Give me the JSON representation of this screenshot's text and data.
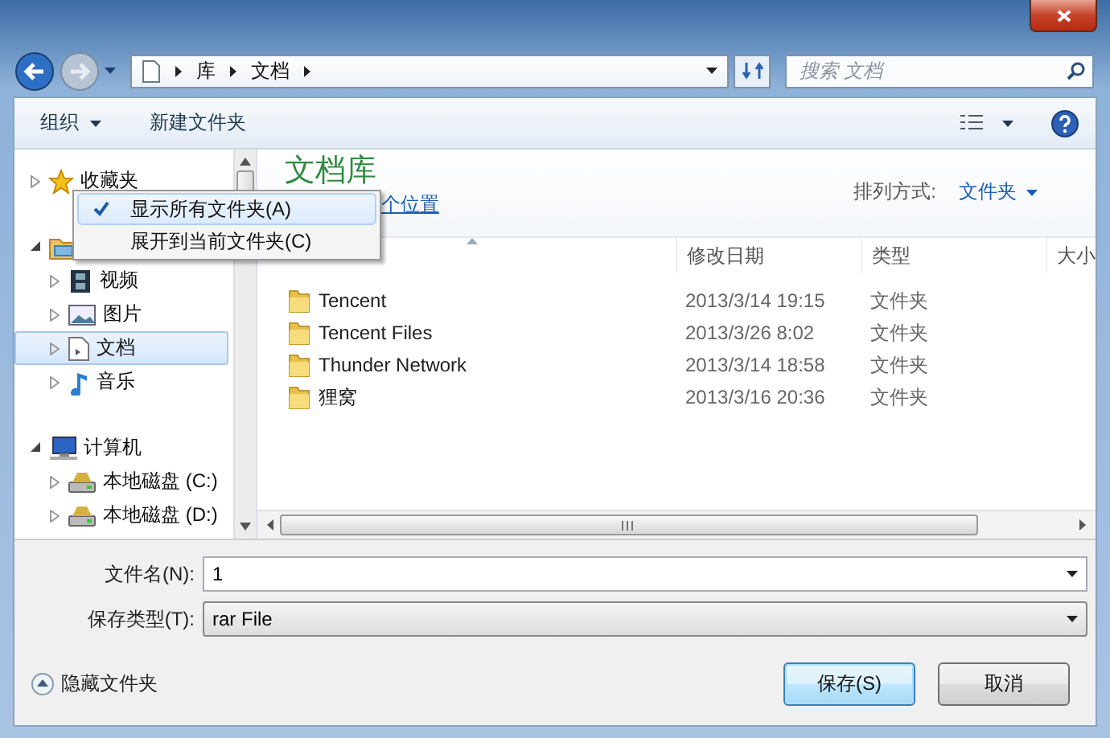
{
  "address_bar": {
    "crumbs": [
      "库",
      "文档"
    ],
    "search": {
      "placeholder": "搜索 文档"
    }
  },
  "toolbar": {
    "buttons": [
      {
        "label": "组织",
        "dropdown": true
      },
      {
        "label": "新建文件夹",
        "dropdown": false
      }
    ]
  },
  "nav_pane": {
    "items": [
      {
        "label": "收藏夹",
        "kind": "star",
        "expanded": false,
        "selected": false
      },
      {
        "kind": "library",
        "expanded": true,
        "selected": false,
        "children": [
          {
            "label": "视频",
            "kind": "video",
            "expanded": false,
            "selected": false
          },
          {
            "label": "图片",
            "kind": "picture",
            "expanded": false,
            "selected": false
          },
          {
            "label": "文档",
            "kind": "document",
            "expanded": false,
            "selected": true
          },
          {
            "label": "音乐",
            "kind": "music",
            "expanded": false,
            "selected": false
          }
        ]
      },
      {
        "label": "计算机",
        "kind": "computer",
        "expanded": true,
        "selected": false,
        "children": [
          {
            "label": "本地磁盘 (C:)",
            "kind": "drive",
            "expanded": false,
            "selected": false
          },
          {
            "label": "本地磁盘 (D:)",
            "kind": "drive",
            "expanded": false,
            "selected": false
          }
        ]
      }
    ]
  },
  "library": {
    "title": "文档库",
    "locations_link": "个位置",
    "sort_label": "排列方式:",
    "sort_value": "文件夹"
  },
  "columns": [
    {
      "sorted": true
    },
    {
      "label": "修改日期",
      "sorted": false
    },
    {
      "label": "类型",
      "sorted": false
    },
    {
      "label": "大小",
      "sorted": false
    }
  ],
  "rows": [
    {
      "name": "Tencent",
      "modified": "2013/3/14 19:15",
      "type": "文件夹"
    },
    {
      "name": "Tencent Files",
      "modified": "2013/3/26 8:02",
      "type": "文件夹"
    },
    {
      "name": "Thunder Network",
      "modified": "2013/3/14 18:58",
      "type": "文件夹"
    },
    {
      "name": "狸窝",
      "modified": "2013/3/16 20:36",
      "type": "文件夹"
    }
  ],
  "context_menu": {
    "items": [
      {
        "label": "显示所有文件夹(A)",
        "checked": true,
        "selected": true
      },
      {
        "label": "展开到当前文件夹(C)",
        "checked": false,
        "selected": false
      }
    ]
  },
  "form": {
    "file_name": {
      "label": "文件名(N):",
      "value": "1"
    },
    "save_type": {
      "label": "保存类型(T):",
      "value": "rar File"
    }
  },
  "hide_folders": "隐藏文件夹",
  "buttons": [
    {
      "label": "保存(S)",
      "default": true
    },
    {
      "label": "取消",
      "default": false
    }
  ]
}
